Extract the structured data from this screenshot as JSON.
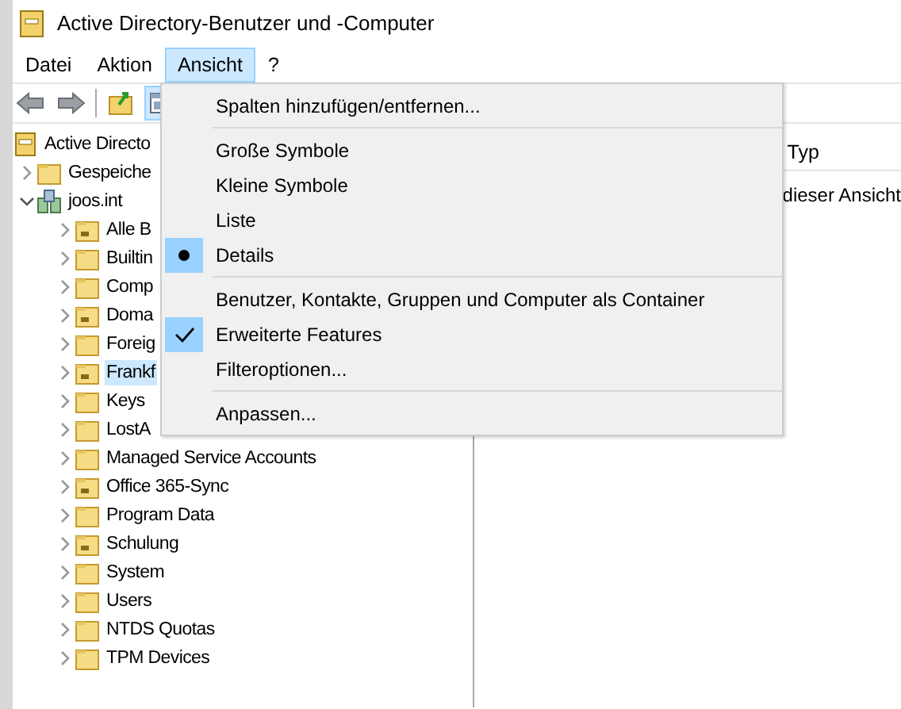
{
  "window": {
    "title": "Active Directory-Benutzer und -Computer"
  },
  "menu_bar": [
    {
      "label": "Datei",
      "selected": false
    },
    {
      "label": "Aktion",
      "selected": false
    },
    {
      "label": "Ansicht",
      "selected": true
    },
    {
      "label": "?",
      "selected": false
    }
  ],
  "tree": [
    {
      "label": "Active Directo",
      "kind": "root",
      "children": [
        {
          "label": "Gespeiche",
          "kind": "folder",
          "expanded": false,
          "selected": false
        },
        {
          "label": "joos.int",
          "kind": "domain",
          "expanded": true,
          "selected": false,
          "children": [
            {
              "label": "Alle B",
              "kind": "ou",
              "expanded": false,
              "selected": false
            },
            {
              "label": "Builtin",
              "kind": "folder",
              "expanded": false,
              "selected": false
            },
            {
              "label": "Comp",
              "kind": "folder",
              "expanded": false,
              "selected": false
            },
            {
              "label": "Doma",
              "kind": "ou",
              "expanded": false,
              "selected": false
            },
            {
              "label": "Foreig",
              "kind": "folder",
              "expanded": false,
              "selected": false
            },
            {
              "label": "Frankf",
              "kind": "ou",
              "expanded": false,
              "selected": true
            },
            {
              "label": "Keys",
              "kind": "folder",
              "expanded": false,
              "selected": false
            },
            {
              "label": "LostA",
              "kind": "folder",
              "expanded": false,
              "selected": false
            },
            {
              "label": "Managed Service Accounts",
              "kind": "folder",
              "expanded": false,
              "selected": false
            },
            {
              "label": "Office 365-Sync",
              "kind": "ou",
              "expanded": false,
              "selected": false
            },
            {
              "label": "Program Data",
              "kind": "folder",
              "expanded": false,
              "selected": false
            },
            {
              "label": "Schulung",
              "kind": "ou",
              "expanded": false,
              "selected": false
            },
            {
              "label": "System",
              "kind": "folder",
              "expanded": false,
              "selected": false
            },
            {
              "label": "Users",
              "kind": "folder",
              "expanded": false,
              "selected": false
            },
            {
              "label": "NTDS Quotas",
              "kind": "folder",
              "expanded": false,
              "selected": false
            },
            {
              "label": "TPM Devices",
              "kind": "folder",
              "expanded": false,
              "selected": false
            }
          ]
        }
      ]
    }
  ],
  "list": {
    "columns": [
      "Typ"
    ],
    "message": "dieser Ansicht"
  },
  "menu": [
    {
      "kind": "command",
      "label": "Spalten hinzufügen/entfernen..."
    },
    {
      "kind": "separator"
    },
    {
      "kind": "radio",
      "label": "Große Symbole",
      "checked": false
    },
    {
      "kind": "radio",
      "label": "Kleine Symbole",
      "checked": false
    },
    {
      "kind": "radio",
      "label": "Liste",
      "checked": false
    },
    {
      "kind": "radio",
      "label": "Details",
      "checked": true
    },
    {
      "kind": "separator"
    },
    {
      "kind": "check",
      "label": "Benutzer, Kontakte, Gruppen und Computer als Container",
      "checked": false
    },
    {
      "kind": "check",
      "label": "Erweiterte Features",
      "checked": true
    },
    {
      "kind": "command",
      "label": "Filteroptionen..."
    },
    {
      "kind": "separator"
    },
    {
      "kind": "command",
      "label": "Anpassen..."
    }
  ]
}
